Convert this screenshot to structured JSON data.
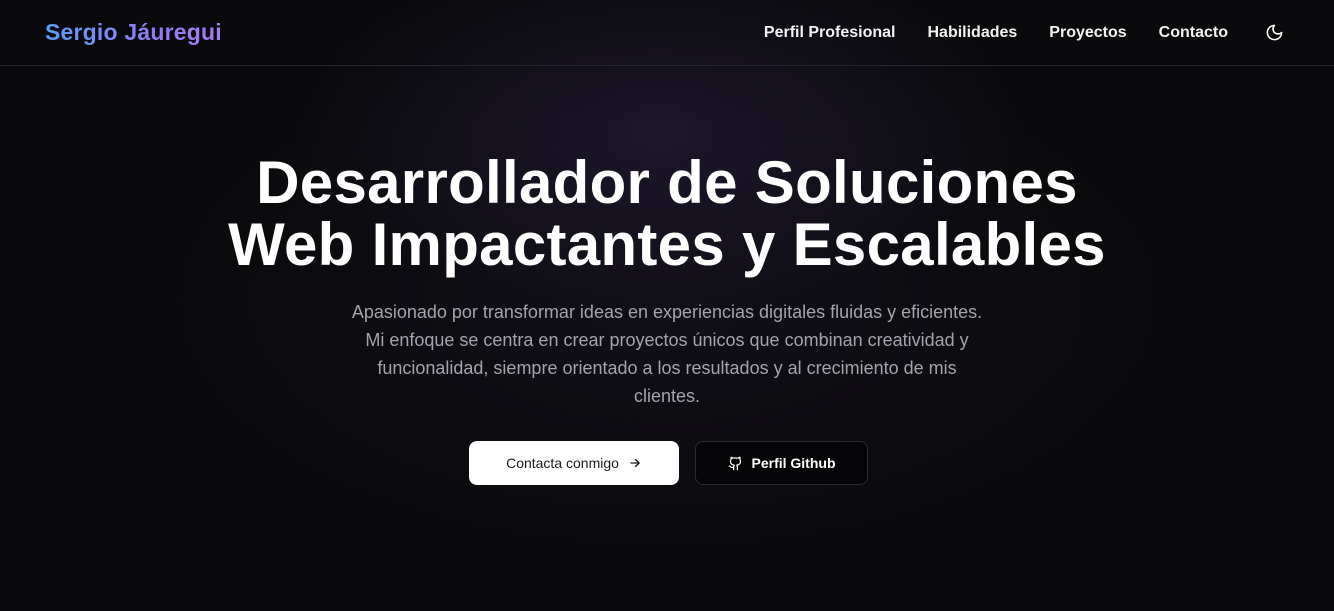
{
  "header": {
    "brand": "Sergio Jáuregui",
    "nav": [
      {
        "label": "Perfil Profesional"
      },
      {
        "label": "Habilidades"
      },
      {
        "label": "Proyectos"
      },
      {
        "label": "Contacto"
      }
    ],
    "theme_icon": "moon-icon"
  },
  "hero": {
    "title_line1": "Desarrollador de Soluciones",
    "title_line2": "Web Impactantes y Escalables",
    "description": "Apasionado por transformar ideas en experiencias digitales fluidas y eficientes. Mi enfoque se centra en crear proyectos únicos que combinan creatividad y funcionalidad, siempre orientado a los resultados y al crecimiento de mis clientes.",
    "primary_button": {
      "label": "Contacta conmigo",
      "icon": "arrow-right-icon"
    },
    "secondary_button": {
      "label": "Perfil Github",
      "icon": "github-icon"
    }
  },
  "colors": {
    "background": "#0a0a0c",
    "brand_gradient_start": "#5b9cf7",
    "brand_gradient_end": "#a67cf2",
    "primary_button_bg": "#ffffff",
    "text_muted": "#a3a3ab"
  }
}
